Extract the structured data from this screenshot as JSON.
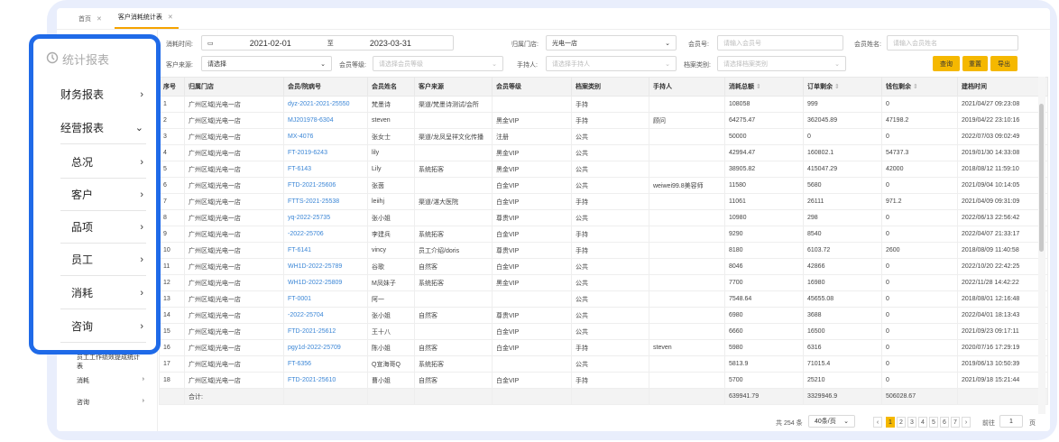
{
  "tabs": [
    {
      "label": "首页",
      "close": "✕"
    },
    {
      "label": "客户消耗统计表",
      "close": "✕"
    }
  ],
  "inner_sidebar": {
    "items": [
      {
        "label": "员工工作绩效提成统计表"
      },
      {
        "label": "消耗",
        "chev": "›"
      },
      {
        "label": "咨询",
        "chev": "›"
      }
    ]
  },
  "filters": {
    "time_label": "消耗时间:",
    "date_start": "2021-02-01",
    "date_sep": "至",
    "date_end": "2023-03-31",
    "store_label": "归属门店:",
    "store_value": "光电一店",
    "member_no_label": "会员号:",
    "member_no_placeholder": "请输入会员号",
    "member_name_label": "会员姓名:",
    "member_name_placeholder": "请输入会员姓名",
    "source_label": "客户来源:",
    "source_value": "请选择",
    "level_label": "会员等级:",
    "level_placeholder": "请选择会员等级",
    "handler_label": "手持人:",
    "handler_placeholder": "请选择手持人",
    "archive_label": "档案类别:",
    "archive_placeholder": "请选择档案类别",
    "btn_query": "查询",
    "btn_reset": "重置",
    "btn_export": "导出"
  },
  "table": {
    "headers": [
      "序号",
      "归属门店",
      "会员/院病号",
      "会员姓名",
      "客户来源",
      "会员等级",
      "档案类别",
      "手持人",
      "消耗总额",
      "订单剩余",
      "钱包剩余",
      "建档时间"
    ],
    "sort_glyph": "⇕",
    "rows": [
      [
        "1",
        "广州区域|光电一店",
        "dyz-2021-2021-25550",
        "梵墨诗",
        "渠道/梵墨诗测试/会所",
        "",
        "手持",
        "",
        "108058",
        "999",
        "0",
        "2021/04/27 09:23:08"
      ],
      [
        "2",
        "广州区域|光电一店",
        "MJ201978-6304",
        "steven",
        "",
        "黑金VIP",
        "手持",
        "顾问",
        "64275.47",
        "362045.89",
        "47198.2",
        "2019/04/22 23:10:16"
      ],
      [
        "3",
        "广州区域|光电一店",
        "MX-4076",
        "张女士",
        "渠道/龙凤呈祥文化传播",
        "注册",
        "公共",
        "",
        "50000",
        "0",
        "0",
        "2022/07/03 09:02:49"
      ],
      [
        "4",
        "广州区域|光电一店",
        "FT-2019-6243",
        "lily",
        "",
        "黑金VIP",
        "公共",
        "",
        "42994.47",
        "160802.1",
        "54737.3",
        "2019/01/30 14:33:08"
      ],
      [
        "5",
        "广州区域|光电一店",
        "FT-6143",
        "Lily",
        "系统拓客",
        "黑金VIP",
        "公共",
        "",
        "38905.82",
        "415047.29",
        "42000",
        "2018/08/12 11:59:10"
      ],
      [
        "6",
        "广州区域|光电一店",
        "FTD-2021-25606",
        "张茵",
        "",
        "白金VIP",
        "公共",
        "weiwei99.8美容师",
        "11580",
        "5680",
        "0",
        "2021/09/04 10:14:05"
      ],
      [
        "7",
        "广州区域|光电一店",
        "FTTS-2021-25538",
        "leiihj",
        "渠道/湛大医院",
        "白金VIP",
        "手持",
        "",
        "11061",
        "26111",
        "971.2",
        "2021/04/09 09:31:09"
      ],
      [
        "8",
        "广州区域|光电一店",
        "yq-2022-25735",
        "张小姐",
        "",
        "尊贵VIP",
        "公共",
        "",
        "10980",
        "298",
        "0",
        "2022/06/13 22:56:42"
      ],
      [
        "9",
        "广州区域|光电一店",
        "-2022-25706",
        "李建兵",
        "系统拓客",
        "白金VIP",
        "手持",
        "",
        "9290",
        "8540",
        "0",
        "2022/04/07 21:33:17"
      ],
      [
        "10",
        "广州区域|光电一店",
        "FT-6141",
        "vincy",
        "员工介绍/doris",
        "尊贵VIP",
        "手持",
        "",
        "8180",
        "6103.72",
        "2600",
        "2018/08/09 11:40:58"
      ],
      [
        "11",
        "广州区域|光电一店",
        "WH1D-2022-25789",
        "谷歌",
        "自然客",
        "白金VIP",
        "公共",
        "",
        "8046",
        "42866",
        "0",
        "2022/10/20 22:42:25"
      ],
      [
        "12",
        "广州区域|光电一店",
        "WH1D-2022-25809",
        "M凤妹子",
        "系统拓客",
        "黑金VIP",
        "公共",
        "",
        "7700",
        "16980",
        "0",
        "2022/11/28 14:42:22"
      ],
      [
        "13",
        "广州区域|光电一店",
        "FT-0001",
        "阿一",
        "",
        "",
        "公共",
        "",
        "7548.64",
        "45655.08",
        "0",
        "2018/08/01 12:16:48"
      ],
      [
        "14",
        "广州区域|光电一店",
        "-2022-25704",
        "张小姐",
        "自然客",
        "尊贵VIP",
        "公共",
        "",
        "6980",
        "3688",
        "0",
        "2022/04/01 18:13:43"
      ],
      [
        "15",
        "广州区域|光电一店",
        "FTD-2021-25612",
        "王十八",
        "",
        "白金VIP",
        "公共",
        "",
        "6660",
        "16500",
        "0",
        "2021/09/23 09:17:11"
      ],
      [
        "16",
        "广州区域|光电一店",
        "pgy1d-2022-25709",
        "陈小姐",
        "自然客",
        "白金VIP",
        "手持",
        "steven",
        "5980",
        "6316",
        "0",
        "2020/07/16 17:29:19"
      ],
      [
        "17",
        "广州区域|光电一店",
        "FT-6356",
        "Q宣海哥Q",
        "系统拓客",
        "",
        "公共",
        "",
        "5813.9",
        "71015.4",
        "0",
        "2019/06/13 10:50:39"
      ],
      [
        "18",
        "广州区域|光电一店",
        "FTD-2021-25610",
        "曹小姐",
        "自然客",
        "白金VIP",
        "手持",
        "",
        "5700",
        "25210",
        "0",
        "2021/09/18 15:21:44"
      ]
    ],
    "summary": {
      "label": "合计:",
      "total_consume": "639941.79",
      "order_remaining": "3329946.9",
      "wallet_remaining": "506028.67"
    }
  },
  "pager": {
    "total": "共 254 条",
    "page_size": "40条/页",
    "prev": "‹",
    "pages": [
      "1",
      "2",
      "3",
      "4",
      "5",
      "6",
      "7"
    ],
    "current": "1",
    "next": "›",
    "goto_label": "前往",
    "goto_value": "1",
    "goto_unit": "页"
  },
  "overlay": {
    "title": "统计报表",
    "items": [
      {
        "label": "财务报表",
        "chev": "›"
      },
      {
        "label": "经营报表",
        "chev": "⌄"
      },
      {
        "label": "总况",
        "chev": "›"
      },
      {
        "label": "客户",
        "chev": "›"
      },
      {
        "label": "品项",
        "chev": "›"
      },
      {
        "label": "员工",
        "chev": "›"
      },
      {
        "label": "消耗",
        "chev": "›"
      },
      {
        "label": "咨询",
        "chev": "›"
      }
    ],
    "highlight_color": "#1f6ae8"
  },
  "colors": {
    "accent": "#f5b800",
    "link": "#3b86d6",
    "frame": "#e9eefc"
  }
}
